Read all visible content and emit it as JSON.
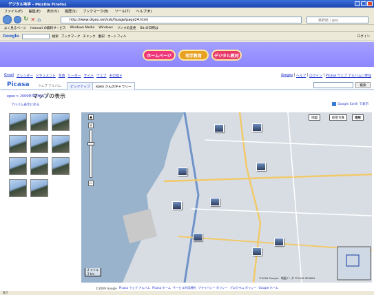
{
  "window": {
    "title": "デジタル地学 - Mozilla Firefox"
  },
  "menu": [
    "ファイル(F)",
    "編集(E)",
    "表示(V)",
    "履歴(S)",
    "ブックマーク(B)",
    "ツール(T)",
    "ヘルプ(H)"
  ],
  "nav": {
    "url": "http://www.digeo.net/sds/frpage/page24.html",
    "search_placeholder": "英辞郎 / goo"
  },
  "bookmarks": [
    "よく見るページ",
    "Hotmail の無料サービス",
    "Windows Media",
    "Windows",
    "リンクの変更",
    "Bit の日時は"
  ],
  "google_toolbar": {
    "logo": "Google",
    "search_btn": "検索",
    "items": [
      "ブックマーク",
      "チェック",
      "翻訳",
      "オートフィル"
    ],
    "login": "ログイン"
  },
  "banner": {
    "buttons": [
      "ホームページ",
      "地学教育",
      "デジタル教材"
    ],
    "colors": {
      "bg": "#9a94ff",
      "home": "#f0367a",
      "edu": "#e8a020",
      "digital": "#e83a6a"
    }
  },
  "google_links": [
    "Gmail",
    "カレンダー",
    "ドキュメント",
    "写真",
    "リーダー",
    "サイト",
    "ウェブ",
    "その他 ▾"
  ],
  "account_links": [
    "dsegeo",
    "ヘルプ",
    "ログイン",
    "Picasa ウェブ アルバムに参加"
  ],
  "picasa": {
    "logo": "Picasa",
    "logo_sub": "ウェブ アルバム",
    "tabs": [
      "ピックアップ",
      "epeo さんのギャラリー"
    ],
    "search_btn": "検索"
  },
  "crumb": "epeo > 2009年3月30日 >",
  "page_title": "マップの表示",
  "back_link": "アルバム表示に戻る",
  "earth_link": "Google Earth で表示",
  "map": {
    "types": [
      "地図",
      "航空写真",
      "地形"
    ],
    "scale": [
      "2 マイル",
      "2 km"
    ],
    "copyright": "©2009 Google - 地図データ ©2009 ZENRIN"
  },
  "footer": [
    "©2009 Google",
    "Picasa ウェブ アルバム",
    "Picasa ホーム",
    "サービス利用規約",
    "プライバシー ポリシー",
    "プログラム ポリシー",
    "Google ホーム"
  ],
  "status": "完了"
}
